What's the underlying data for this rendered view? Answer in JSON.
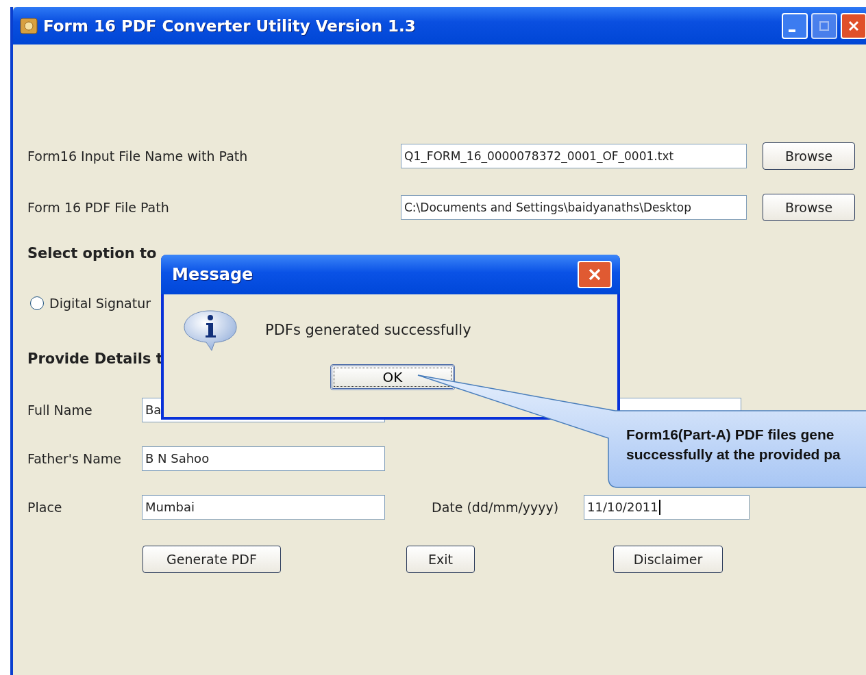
{
  "window": {
    "title": "Form 16 PDF Converter Utility Version 1.3"
  },
  "file_rows": [
    {
      "label": "Form16 Input File Name with Path",
      "value": "Q1_FORM_16_0000078372_0001_OF_0001.txt",
      "button": "Browse"
    },
    {
      "label": "Form 16  PDF File Path",
      "value": "C:\\Documents and Settings\\baidyanaths\\Desktop",
      "button": "Browse"
    }
  ],
  "select_heading": "Select option to",
  "radio": {
    "label": "Digital Signatur",
    "selected": false
  },
  "details_heading": "Provide Details t",
  "full_name": {
    "label": "Full Name",
    "value": "Ba"
  },
  "fathers_name": {
    "label": "Father's Name",
    "value": "B N Sahoo"
  },
  "place": {
    "label": "Place",
    "value": "Mumbai"
  },
  "date": {
    "label": "Date (dd/mm/yyyy)",
    "value": "11/10/2011"
  },
  "buttons": [
    "Generate PDF",
    "Exit",
    "Disclaimer"
  ],
  "dialog": {
    "title": "Message",
    "message": "PDFs generated successfully",
    "button": "OK"
  },
  "callout": {
    "lines": [
      "Form16(Part-A) PDF files gene",
      "successfully at the provided pa"
    ]
  }
}
